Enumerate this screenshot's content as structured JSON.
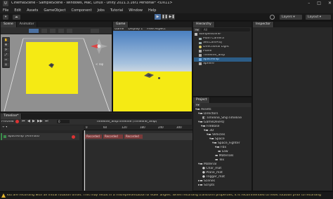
{
  "window": {
    "title": "CinemaScene - SampleScene - Windows, Mac, Linux - Unity 2021.3.16f1 Personal* <DX11>",
    "app_icon_glyph": "U",
    "controls": [
      "–",
      "□",
      "✕"
    ]
  },
  "menu": [
    "File",
    "Edit",
    "Assets",
    "GameObject",
    "Component",
    "Jobs",
    "Tutorial",
    "Window",
    "Help"
  ],
  "toolbar": {
    "account_label": "▾",
    "cloud_label": "☁",
    "play": "▶",
    "pause": "❚❚",
    "step": "▶❚",
    "layers_label": "Layers ▾",
    "layout_label": "Layout ▾"
  },
  "scene_panel": {
    "tab_scene": "Scene",
    "tab_animator": "Animator",
    "persp_label": "< Top",
    "gizmo_labels": [
      "y",
      "x",
      "z"
    ],
    "tool_icons": [
      "✋",
      "✥",
      "⟳",
      "⤢",
      "▭",
      "◎"
    ]
  },
  "game_panel": {
    "tab": "Game",
    "display_mode": "Game",
    "display_label": "Display 1",
    "aspect_label": "Free Aspect"
  },
  "hierarchy": {
    "tab": "Hierarchy",
    "search_placeholder": "All",
    "items": [
      {
        "label": "SampleScene*",
        "indent": 0,
        "color": "#cfcfcf",
        "icon": "unity-scene-icon"
      },
      {
        "label": "Main Camera",
        "indent": 1,
        "color": "#cfcfcf",
        "icon": "camera-icon"
      },
      {
        "label": "SecCamProj",
        "indent": 1,
        "color": "#cfcfcf",
        "icon": "camera-icon"
      },
      {
        "label": "Directional Light",
        "indent": 1,
        "color": "#cfcfcf",
        "icon": "light-icon"
      },
      {
        "label": "Plane",
        "indent": 1,
        "color": "#cfcfcf",
        "icon": "cube-icon"
      },
      {
        "label": "Timeline_Ship",
        "indent": 1,
        "color": "#cfcfcf",
        "icon": "cube-icon"
      },
      {
        "label": "Spaceship",
        "indent": 1,
        "color": "#7fb4e8",
        "icon": "prefab-icon"
      },
      {
        "label": "Sphere",
        "indent": 1,
        "color": "#cfcfcf",
        "icon": "cube-icon"
      }
    ]
  },
  "inspector": {
    "tab": "Inspector"
  },
  "project": {
    "tab": "Project",
    "items": [
      {
        "label": "Assets",
        "indent": 0
      },
      {
        "label": "Directors",
        "indent": 1
      },
      {
        "label": "Timeline_ShipTimeline",
        "indent": 2
      },
      {
        "label": "GameDevHQ",
        "indent": 1
      },
      {
        "label": "FileBase",
        "indent": 2
      },
      {
        "label": "3D",
        "indent": 3
      },
      {
        "label": "Vehicles",
        "indent": 4
      },
      {
        "label": "Space",
        "indent": 5
      },
      {
        "label": "Space_Fighter",
        "indent": 6
      },
      {
        "label": "Fbx",
        "indent": 7
      },
      {
        "label": "Low",
        "indent": 8
      },
      {
        "label": "Materials",
        "indent": 7
      },
      {
        "label": "Tex",
        "indent": 7
      },
      {
        "label": "Material",
        "indent": 1
      },
      {
        "label": "Char_mat",
        "indent": 2
      },
      {
        "label": "Plane_mat",
        "indent": 2
      },
      {
        "label": "Trigger_mat",
        "indent": 2
      },
      {
        "label": "Scenes",
        "indent": 1
      },
      {
        "label": "Scripts",
        "indent": 1
      }
    ]
  },
  "timeline": {
    "tab": "Timeline*",
    "preview_label": "Preview",
    "frame_value": "0",
    "asset_label": "Timeline_ShipTimeline (Timeline_Ship)",
    "add_label": "+ ▾",
    "track_label": "Spaceship (Animato",
    "ruler_labels": [
      "0",
      "60",
      "120",
      "180",
      "240",
      "300"
    ],
    "clips": [
      "Recorded",
      "Recorded",
      "Recorded"
    ]
  },
  "status": {
    "message": "You are recording with an initial rotation offset. This may result in a misrepresentation of euler angles. When recording transform properties, it is recommended to reset rotation prior to recording"
  },
  "colors": {
    "yellow": "#f5ea14",
    "sky_top": "#5d8ec6",
    "selected_blue": "#2c5d87"
  }
}
